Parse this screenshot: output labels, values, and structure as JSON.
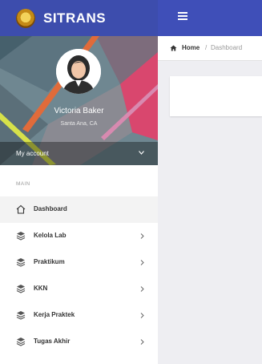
{
  "header": {
    "brand_name": "SITRANS",
    "menu_icon": "hamburger-menu-icon",
    "logo_icon": "sitrans-logo-icon",
    "brand_color": "#3d4dad"
  },
  "profile": {
    "name": "Victoria Baker",
    "location": "Santa Ana, CA",
    "account_label": "My account"
  },
  "sidebar": {
    "section_label": "MAIN",
    "items": [
      {
        "label": "Dashboard",
        "icon": "home-icon",
        "has_submenu": false,
        "active": true
      },
      {
        "label": "Kelola Lab",
        "icon": "layers-icon",
        "has_submenu": true
      },
      {
        "label": "Praktikum",
        "icon": "layers-icon",
        "has_submenu": true
      },
      {
        "label": "KKN",
        "icon": "layers-icon",
        "has_submenu": true
      },
      {
        "label": "Kerja Praktek",
        "icon": "layers-icon",
        "has_submenu": true
      },
      {
        "label": "Tugas Akhir",
        "icon": "layers-icon",
        "has_submenu": true
      }
    ]
  },
  "breadcrumb": {
    "home": "Home",
    "separator": "/",
    "current": "Dashboard"
  }
}
